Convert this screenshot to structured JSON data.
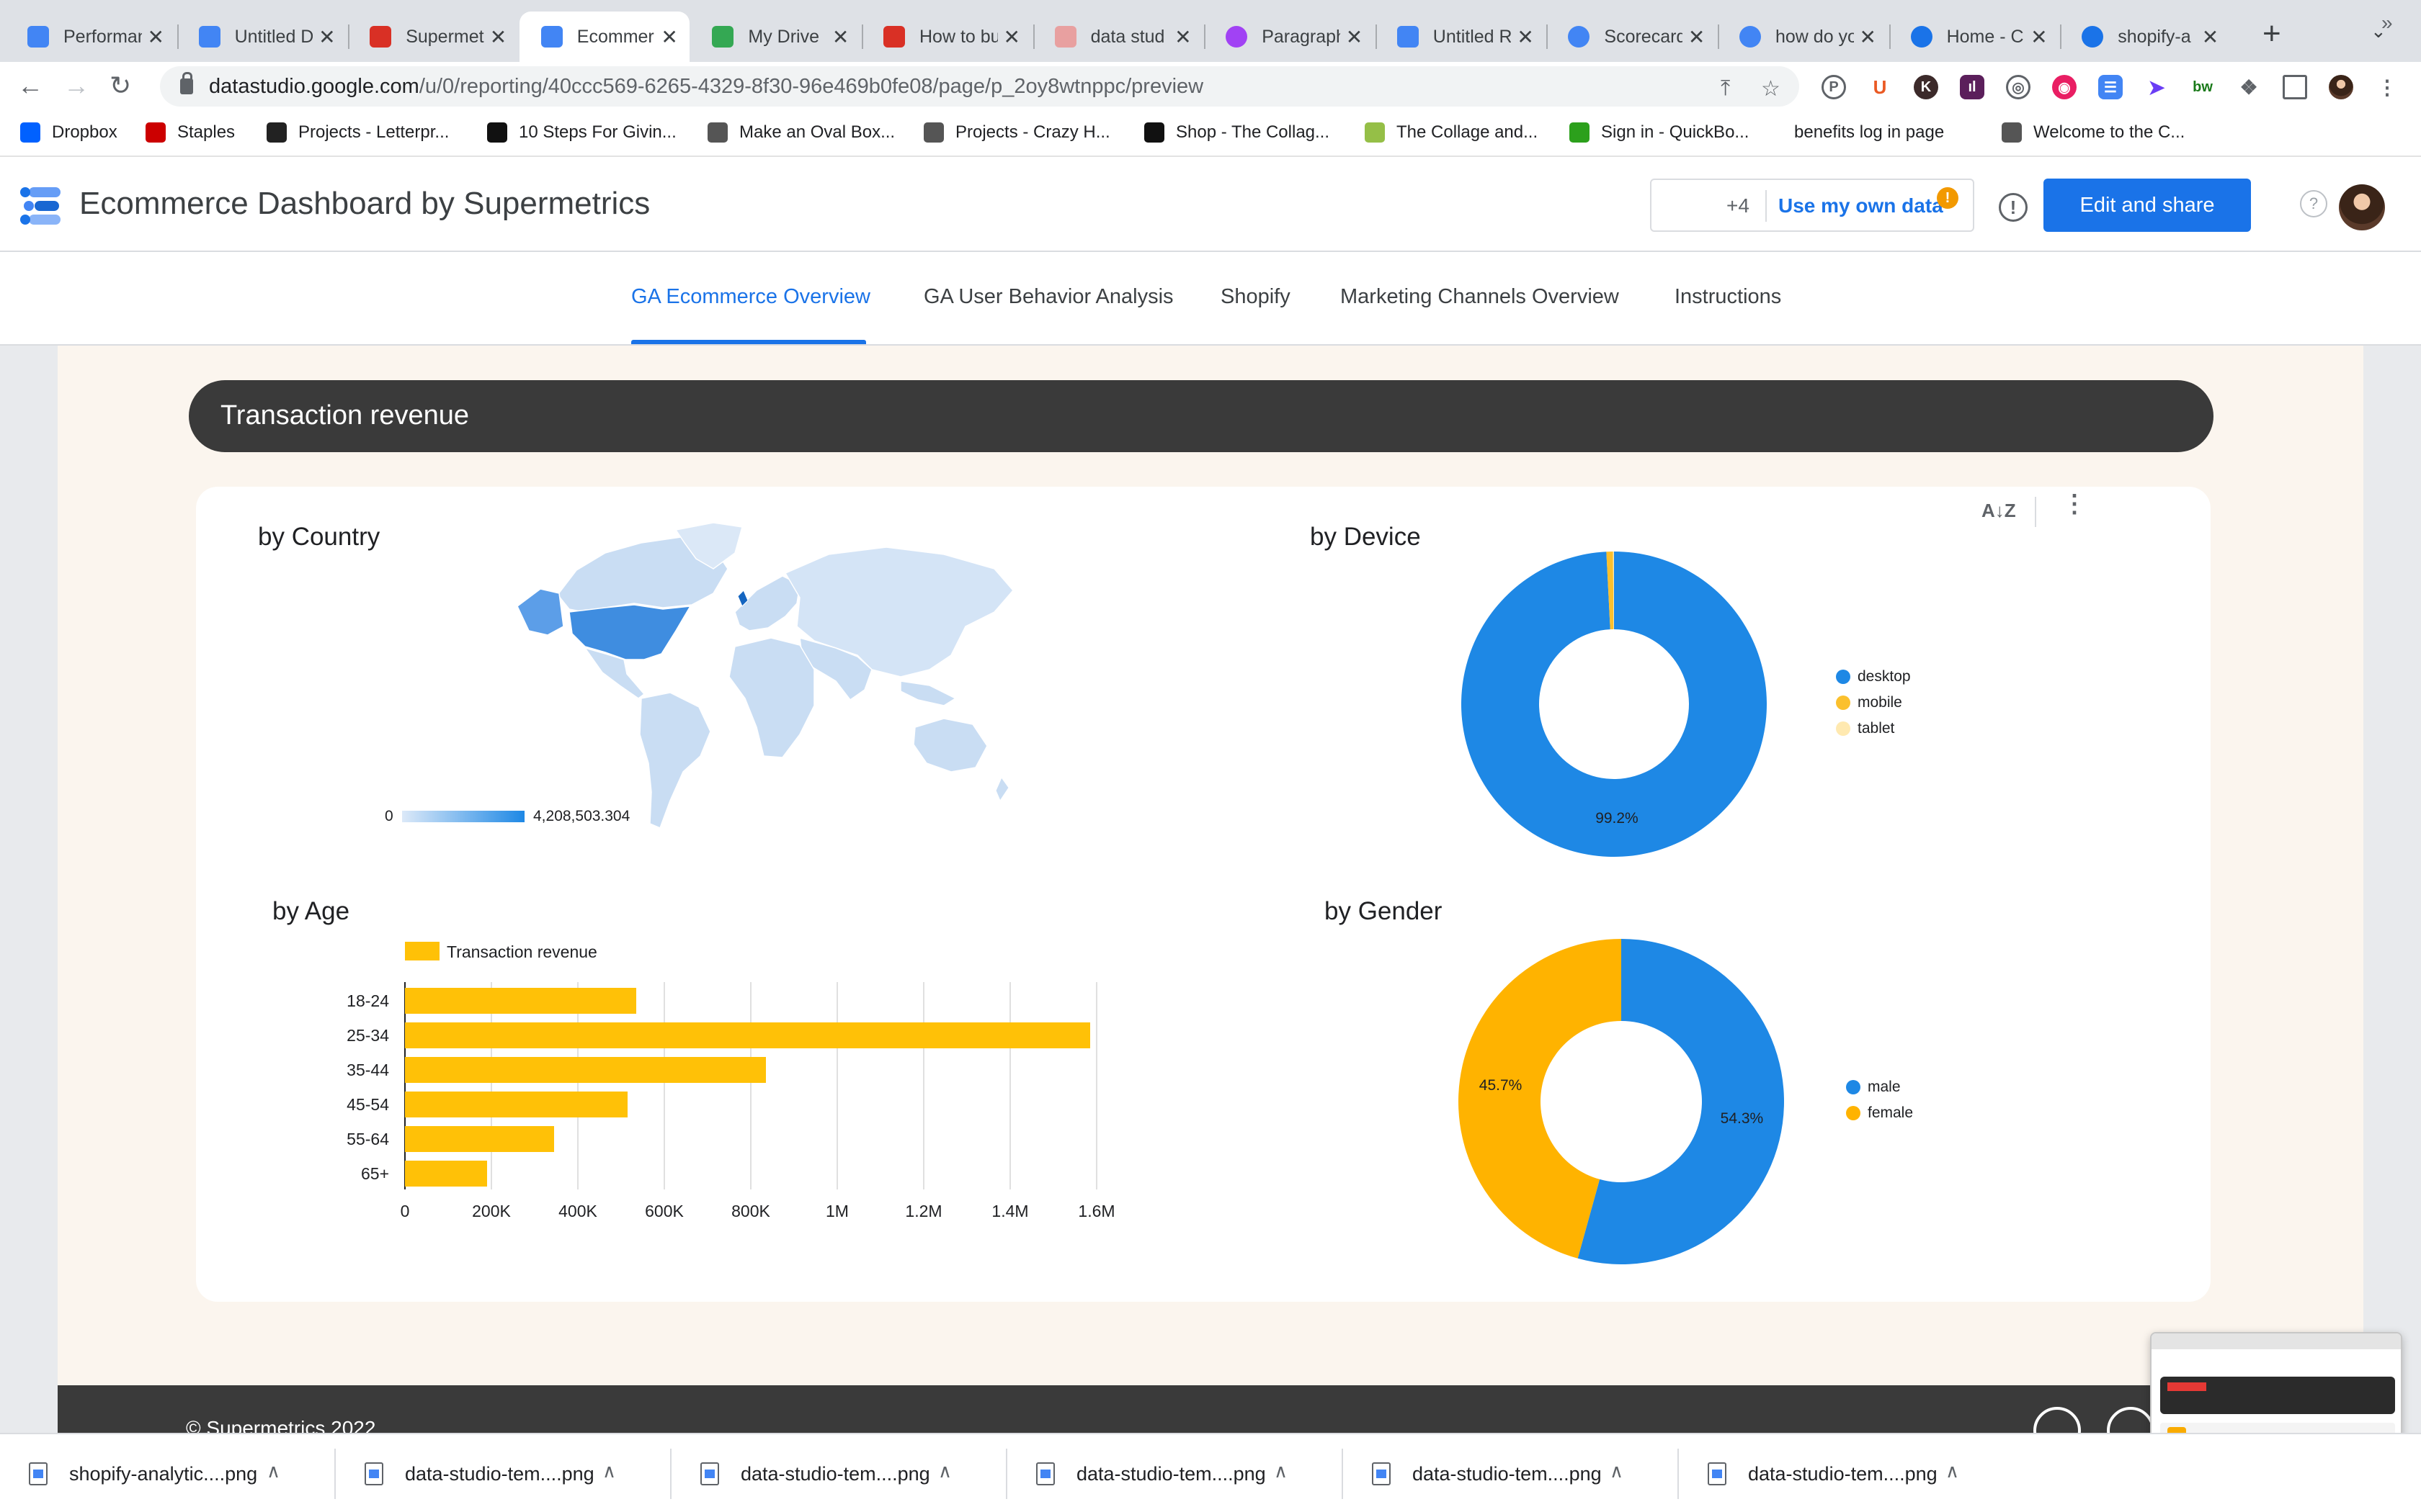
{
  "browser": {
    "tabs": [
      {
        "title": "Performan",
        "icon": "datastudio",
        "color": "#4285f4"
      },
      {
        "title": "Untitled D",
        "icon": "datastudio",
        "color": "#4285f4"
      },
      {
        "title": "Supermet",
        "icon": "supermetrics",
        "color": "#d93025"
      },
      {
        "title": "Ecommer",
        "icon": "datastudio",
        "color": "#4285f4"
      },
      {
        "title": "My Drive",
        "icon": "drive",
        "color": "#34a853"
      },
      {
        "title": "How to bu",
        "icon": "supermetrics",
        "color": "#d93025"
      },
      {
        "title": "data stud",
        "icon": "doc",
        "color": "#e8a0a0"
      },
      {
        "title": "Paragraph",
        "icon": "circle",
        "color": "#a142f4"
      },
      {
        "title": "Untitled R",
        "icon": "datastudio",
        "color": "#4285f4"
      },
      {
        "title": "Scorecard",
        "icon": "google",
        "color": "#4285f4"
      },
      {
        "title": "how do yo",
        "icon": "google",
        "color": "#4285f4"
      },
      {
        "title": "Home - C",
        "icon": "circle",
        "color": "#1a73e8"
      },
      {
        "title": "shopify-a",
        "icon": "circle",
        "color": "#1a73e8"
      }
    ],
    "active_tab_index": 3,
    "url_host": "datastudio.google.com",
    "url_path": "/u/0/reporting/40ccc569-6265-4329-8f30-96e469b0fe08/page/p_2oy8wtnppc/preview",
    "bookmarks": [
      {
        "label": "Dropbox",
        "color": "#0061ff"
      },
      {
        "label": "Staples",
        "color": "#cc0000"
      },
      {
        "label": "Projects - Letterpr...",
        "color": "#222222"
      },
      {
        "label": "10 Steps For Givin...",
        "color": "#111111"
      },
      {
        "label": "Make an Oval Box...",
        "color": "#555555"
      },
      {
        "label": "Projects - Crazy H...",
        "color": "#555555"
      },
      {
        "label": "Shop - The Collag...",
        "color": "#111111"
      },
      {
        "label": "The Collage and...",
        "color": "#95bf47"
      },
      {
        "label": "Sign in - QuickBo...",
        "color": "#2ca01c"
      },
      {
        "label": "benefits log in page",
        "color": ""
      },
      {
        "label": "Welcome to the C...",
        "color": "#555555"
      }
    ]
  },
  "app": {
    "title": "Ecommerce Dashboard by Supermetrics",
    "viewers_extra": "+4",
    "use_own_data": "Use my own data",
    "edit_share": "Edit and share",
    "help": "?",
    "info": "!"
  },
  "page_tabs": [
    "GA Ecommerce Overview",
    "GA User Behavior Analysis",
    "Shopify",
    "Marketing Channels Overview",
    "Instructions"
  ],
  "active_page_tab": 0,
  "section": {
    "title": "Transaction revenue",
    "sort_icon": "A↓Z"
  },
  "charts": {
    "country_title": "by Country",
    "device_title": "by Device",
    "age_title": "by Age",
    "gender_title": "by Gender",
    "map_legend_min": "0",
    "map_legend_max": "4,208,503.304"
  },
  "chart_data": [
    {
      "type": "map",
      "title": "by Country",
      "metric": "Transaction revenue",
      "range": [
        0,
        4208503.304
      ],
      "highlighted_regions": [
        "United States",
        "Canada",
        "Ireland",
        "Alaska"
      ]
    },
    {
      "type": "pie",
      "title": "by Device",
      "donut": true,
      "labels": [
        "desktop",
        "mobile",
        "tablet"
      ],
      "values": [
        99.2,
        0.7,
        0.1
      ],
      "shown_labels": [
        "99.2%",
        "",
        ""
      ],
      "colors": [
        "#1e88e5",
        "#fbc02d",
        "#ffe9b0"
      ],
      "legend_position": "right"
    },
    {
      "type": "bar",
      "orientation": "horizontal",
      "title": "by Age",
      "series": [
        {
          "name": "Transaction revenue",
          "values": [
            535000,
            1585000,
            835000,
            515000,
            345000,
            190000
          ]
        }
      ],
      "categories": [
        "18-24",
        "25-34",
        "35-44",
        "45-54",
        "55-64",
        "65+"
      ],
      "xlim": [
        0,
        1600000
      ],
      "xticks": [
        "0",
        "200K",
        "400K",
        "600K",
        "800K",
        "1M",
        "1.2M",
        "1.4M",
        "1.6M"
      ],
      "color": "#ffc107",
      "legend_position": "top"
    },
    {
      "type": "pie",
      "title": "by Gender",
      "donut": true,
      "labels": [
        "male",
        "female"
      ],
      "values": [
        54.3,
        45.7
      ],
      "shown_labels": [
        "54.3%",
        "45.7%"
      ],
      "colors": [
        "#1e88e5",
        "#ffb300"
      ],
      "legend_position": "right"
    }
  ],
  "footer": {
    "copyright": "© Supermetrics 2022"
  },
  "downloads": [
    "shopify-analytic....png",
    "data-studio-tem....png",
    "data-studio-tem....png",
    "data-studio-tem....png",
    "data-studio-tem....png",
    "data-studio-tem....png"
  ]
}
